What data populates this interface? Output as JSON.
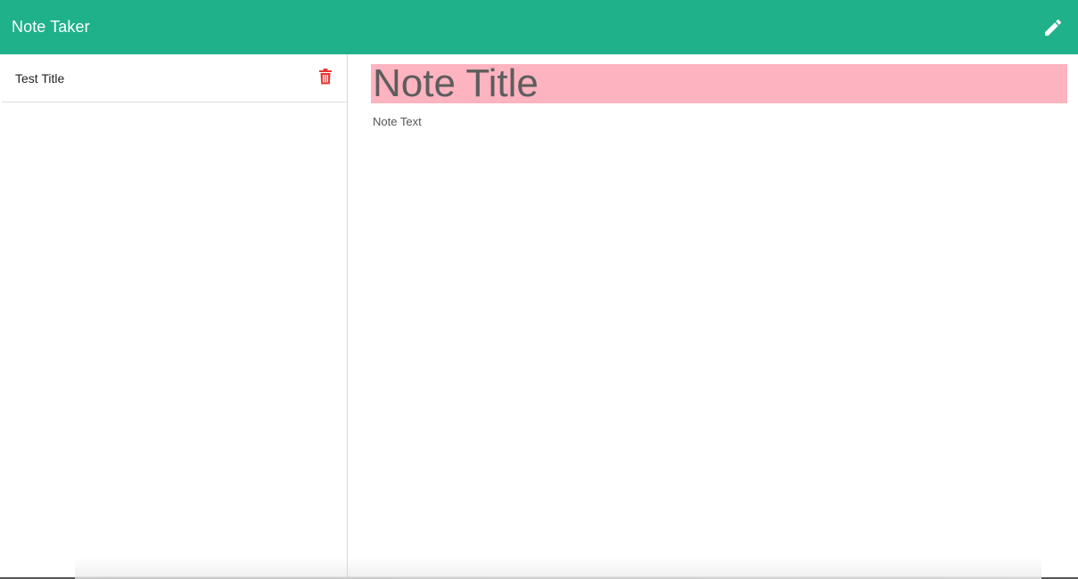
{
  "navbar": {
    "brand": "Note Taker",
    "new_note_icon": "pencil-icon"
  },
  "sidebar": {
    "notes": [
      {
        "title": "Test Title",
        "delete_icon": "trash-icon"
      }
    ]
  },
  "editor": {
    "title_placeholder": "Note Title",
    "text_placeholder": "Note Text"
  },
  "colors": {
    "navbar_bg": "#1fb18a",
    "title_bg": "#fdb3c0",
    "delete_red": "#e53935"
  }
}
